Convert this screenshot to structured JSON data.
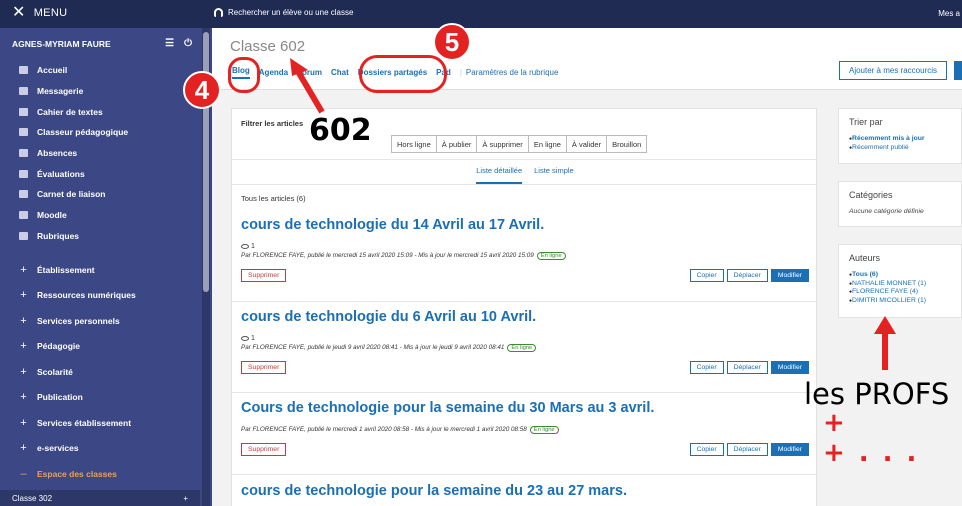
{
  "topbar": {
    "menu_label": "MENU",
    "search_label": "Rechercher un élève ou une classe",
    "right_label": "Mes a"
  },
  "sidebar": {
    "user": "AGNES-MYRIAM FAURE",
    "items": [
      {
        "label": "Accueil",
        "icon": "grid-icon"
      },
      {
        "label": "Messagerie",
        "icon": "mail-icon"
      },
      {
        "label": "Cahier de textes",
        "icon": "book-icon"
      },
      {
        "label": "Classeur pédagogique",
        "icon": "folder-icon"
      },
      {
        "label": "Absences",
        "icon": "person-icon"
      },
      {
        "label": "Évaluations",
        "icon": "bar-chart-icon"
      },
      {
        "label": "Carnet de liaison",
        "icon": "link-icon"
      },
      {
        "label": "Moodle",
        "icon": "moodle-icon"
      },
      {
        "label": "Rubriques",
        "icon": "chat-icon"
      }
    ],
    "sections": [
      {
        "label": "Établissement",
        "icon": "+"
      },
      {
        "label": "Ressources numériques",
        "icon": "+"
      },
      {
        "label": "Services personnels",
        "icon": "+"
      },
      {
        "label": "Pédagogie",
        "icon": "+"
      },
      {
        "label": "Scolarité",
        "icon": "+"
      },
      {
        "label": "Publication",
        "icon": "+"
      },
      {
        "label": "Services établissement",
        "icon": "+"
      },
      {
        "label": "e-services",
        "icon": "+"
      },
      {
        "label": "Espace des classes",
        "icon": "–"
      }
    ],
    "class_item": "Classe 302",
    "class_plus": "+"
  },
  "header": {
    "title": "Classe 602",
    "tabs": [
      "Blog",
      "Agenda",
      "Forum",
      "Chat",
      "Dossiers partagés",
      "Pad"
    ],
    "params": "Paramètres de la rubrique",
    "shortcut": "Ajouter à mes raccourcis"
  },
  "articles": {
    "filter_label": "Filtrer les articles",
    "filters": [
      "Hors ligne",
      "À publier",
      "À supprimer",
      "En ligne",
      "À valider",
      "Brouillon"
    ],
    "views": [
      "Liste détaillée",
      "Liste simple"
    ],
    "count": "Tous les articles (6)",
    "posts": [
      {
        "title": "cours de technologie du 14 Avril au 17 Avril.",
        "views": "1",
        "meta": "Par FLORENCE FAYE, publié le mercredi 15 avril 2020 15:09 - Mis à jour le mercredi 15 avril 2020 15:09",
        "status": "En ligne"
      },
      {
        "title": "cours de technologie du 6 Avril au 10 Avril.",
        "views": "1",
        "meta": "Par FLORENCE FAYE, publié le jeudi 9 avril 2020 08:41 - Mis à jour le jeudi 9 avril 2020 08:41",
        "status": "En ligne"
      },
      {
        "title": "Cours de technologie pour la semaine du 30 Mars au 3 avril.",
        "views": "",
        "meta": "Par FLORENCE FAYE, publié le mercredi 1 avril 2020 08:58 - Mis à jour le mercredi 1 avril 2020 08:58",
        "status": "En ligne"
      },
      {
        "title": "cours de technologie pour la semaine du 23 au 27 mars.",
        "views": "",
        "meta": "",
        "status": ""
      }
    ],
    "buttons": {
      "delete": "Supprimer",
      "copy": "Copier",
      "move": "Déplacer",
      "edit": "Modifier"
    }
  },
  "right": {
    "sort": {
      "title": "Trier par",
      "items": [
        "Récemment mis à jour",
        "Récemment publié"
      ]
    },
    "categories": {
      "title": "Catégories",
      "note": "Aucune catégorie définie"
    },
    "authors": {
      "title": "Auteurs",
      "items": [
        "Tous (6)",
        "NATHALIE MONNET (1)",
        "FLORENCE FAYE (4)",
        "DIMITRI MICOLLIER (1)"
      ]
    }
  },
  "annotations": {
    "num4": "4",
    "num5": "5",
    "label_602": "602",
    "profs": "les PROFS",
    "plus_line": "+ +..."
  },
  "colors": {
    "sidebar": "#3b4885",
    "topbar": "#1f2b52",
    "accent": "#1a6fb5",
    "annotation": "#e52222",
    "active_section": "#f0a04b"
  }
}
